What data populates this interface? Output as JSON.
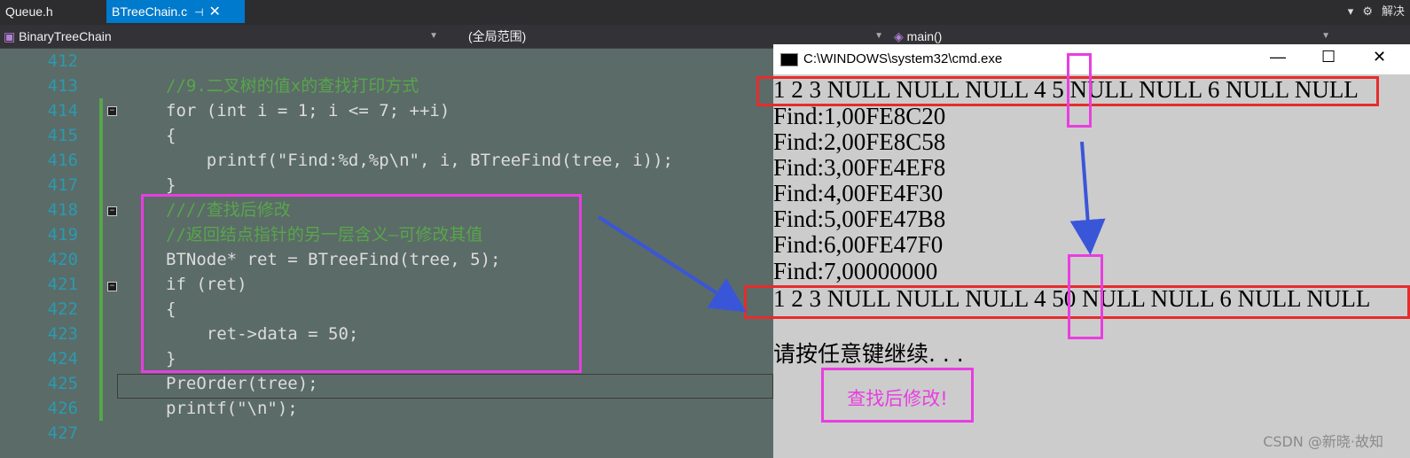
{
  "tabs": [
    {
      "label": "Queue.h"
    },
    {
      "label": "BTreeChain.c",
      "pin": "⊣",
      "close": "✕"
    }
  ],
  "topright": "解决",
  "nav": {
    "project": "BinaryTreeChain",
    "scope": "(全局范围)",
    "function": "main()"
  },
  "editor": {
    "lines": [
      {
        "n": "412",
        "text": ""
      },
      {
        "n": "413",
        "text": "//9.二叉树的值x的查找打印方式"
      },
      {
        "n": "414",
        "text": "for (int i = 1; i <= 7; ++i)"
      },
      {
        "n": "415",
        "text": "{"
      },
      {
        "n": "416",
        "text": "    printf(\"Find:%d,%p\\n\", i, BTreeFind(tree, i));"
      },
      {
        "n": "417",
        "text": "}"
      },
      {
        "n": "418",
        "text": "////查找后修改"
      },
      {
        "n": "419",
        "text": "//返回结点指针的另一层含义—可修改其值"
      },
      {
        "n": "420",
        "text": "BTNode* ret = BTreeFind(tree, 5);"
      },
      {
        "n": "421",
        "text": "if (ret)"
      },
      {
        "n": "422",
        "text": "{"
      },
      {
        "n": "423",
        "text": "    ret->data = 50;"
      },
      {
        "n": "424",
        "text": "}"
      },
      {
        "n": "425",
        "text": "PreOrder(tree);"
      },
      {
        "n": "426",
        "text": "printf(\"\\n\");"
      },
      {
        "n": "427",
        "text": ""
      }
    ]
  },
  "console": {
    "title": "C:\\WINDOWS\\system32\\cmd.exe",
    "controls": {
      "min": "—",
      "max": "☐",
      "close": "✕"
    },
    "lines": [
      "1 2 3 NULL NULL NULL 4 5 NULL NULL 6 NULL NULL",
      "Find:1,00FE8C20",
      "Find:2,00FE8C58",
      "Find:3,00FE4EF8",
      "Find:4,00FE4F30",
      "Find:5,00FE47B8",
      "Find:6,00FE47F0",
      "Find:7,00000000",
      "1 2 3 NULL NULL NULL 4 50 NULL NULL 6 NULL NULL",
      "",
      "请按任意键继续. . ."
    ]
  },
  "annotation_label": "查找后修改!",
  "watermark": "CSDN @新晓·故知",
  "colors": {
    "red_box": "#e62c2c",
    "magenta_box": "#e83ee0",
    "arrow": "#3a56d8",
    "tab_active": "#007acc"
  }
}
